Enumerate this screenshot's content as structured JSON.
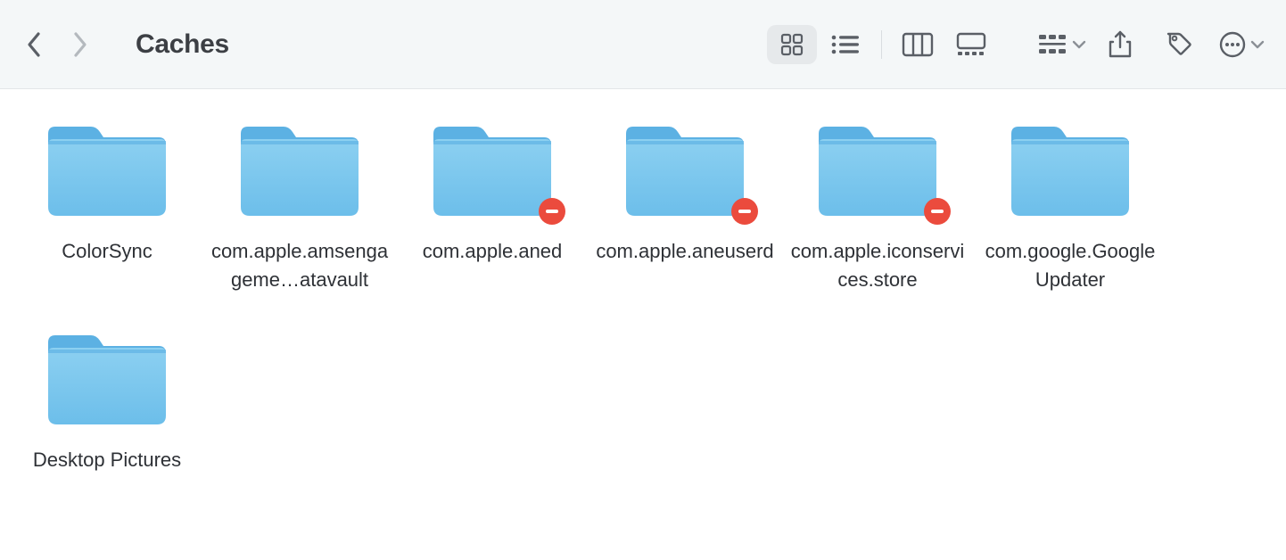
{
  "header": {
    "title": "Caches",
    "active_view": "icon"
  },
  "folders": [
    {
      "label": "ColorSync",
      "restricted": false
    },
    {
      "label": "com.apple.amsengageme…atavault",
      "restricted": false
    },
    {
      "label": "com.apple.aned",
      "restricted": true
    },
    {
      "label": "com.apple.aneuserd",
      "restricted": true
    },
    {
      "label": "com.apple.iconservices.store",
      "restricted": true
    },
    {
      "label": "com.google.GoogleUpdater",
      "restricted": false
    },
    {
      "label": "Desktop Pictures",
      "restricted": false
    }
  ],
  "colors": {
    "folder_light": "#7ec7ed",
    "folder_dark": "#54aee4",
    "badge": "#eb4b3d"
  }
}
